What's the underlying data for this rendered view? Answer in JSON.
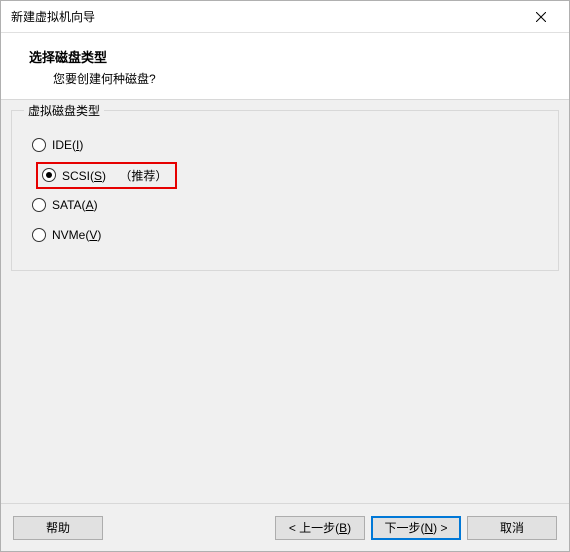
{
  "window": {
    "title": "新建虚拟机向导"
  },
  "header": {
    "title": "选择磁盘类型",
    "subtitle": "您要创建何种磁盘?"
  },
  "group": {
    "title": "虚拟磁盘类型",
    "options": [
      {
        "prefix": "IDE(",
        "mnemonic": "I",
        "suffix": ")",
        "recommend": "",
        "selected": false
      },
      {
        "prefix": "SCSI(",
        "mnemonic": "S",
        "suffix": ")",
        "recommend": "（推荐）",
        "selected": true
      },
      {
        "prefix": "SATA(",
        "mnemonic": "A",
        "suffix": ")",
        "recommend": "",
        "selected": false
      },
      {
        "prefix": "NVMe(",
        "mnemonic": "V",
        "suffix": ")",
        "recommend": "",
        "selected": false
      }
    ]
  },
  "footer": {
    "help": "帮助",
    "back_prefix": "< 上一步(",
    "back_mnemonic": "B",
    "back_suffix": ")",
    "next_prefix": "下一步(",
    "next_mnemonic": "N",
    "next_suffix": ") >",
    "cancel": "取消"
  }
}
